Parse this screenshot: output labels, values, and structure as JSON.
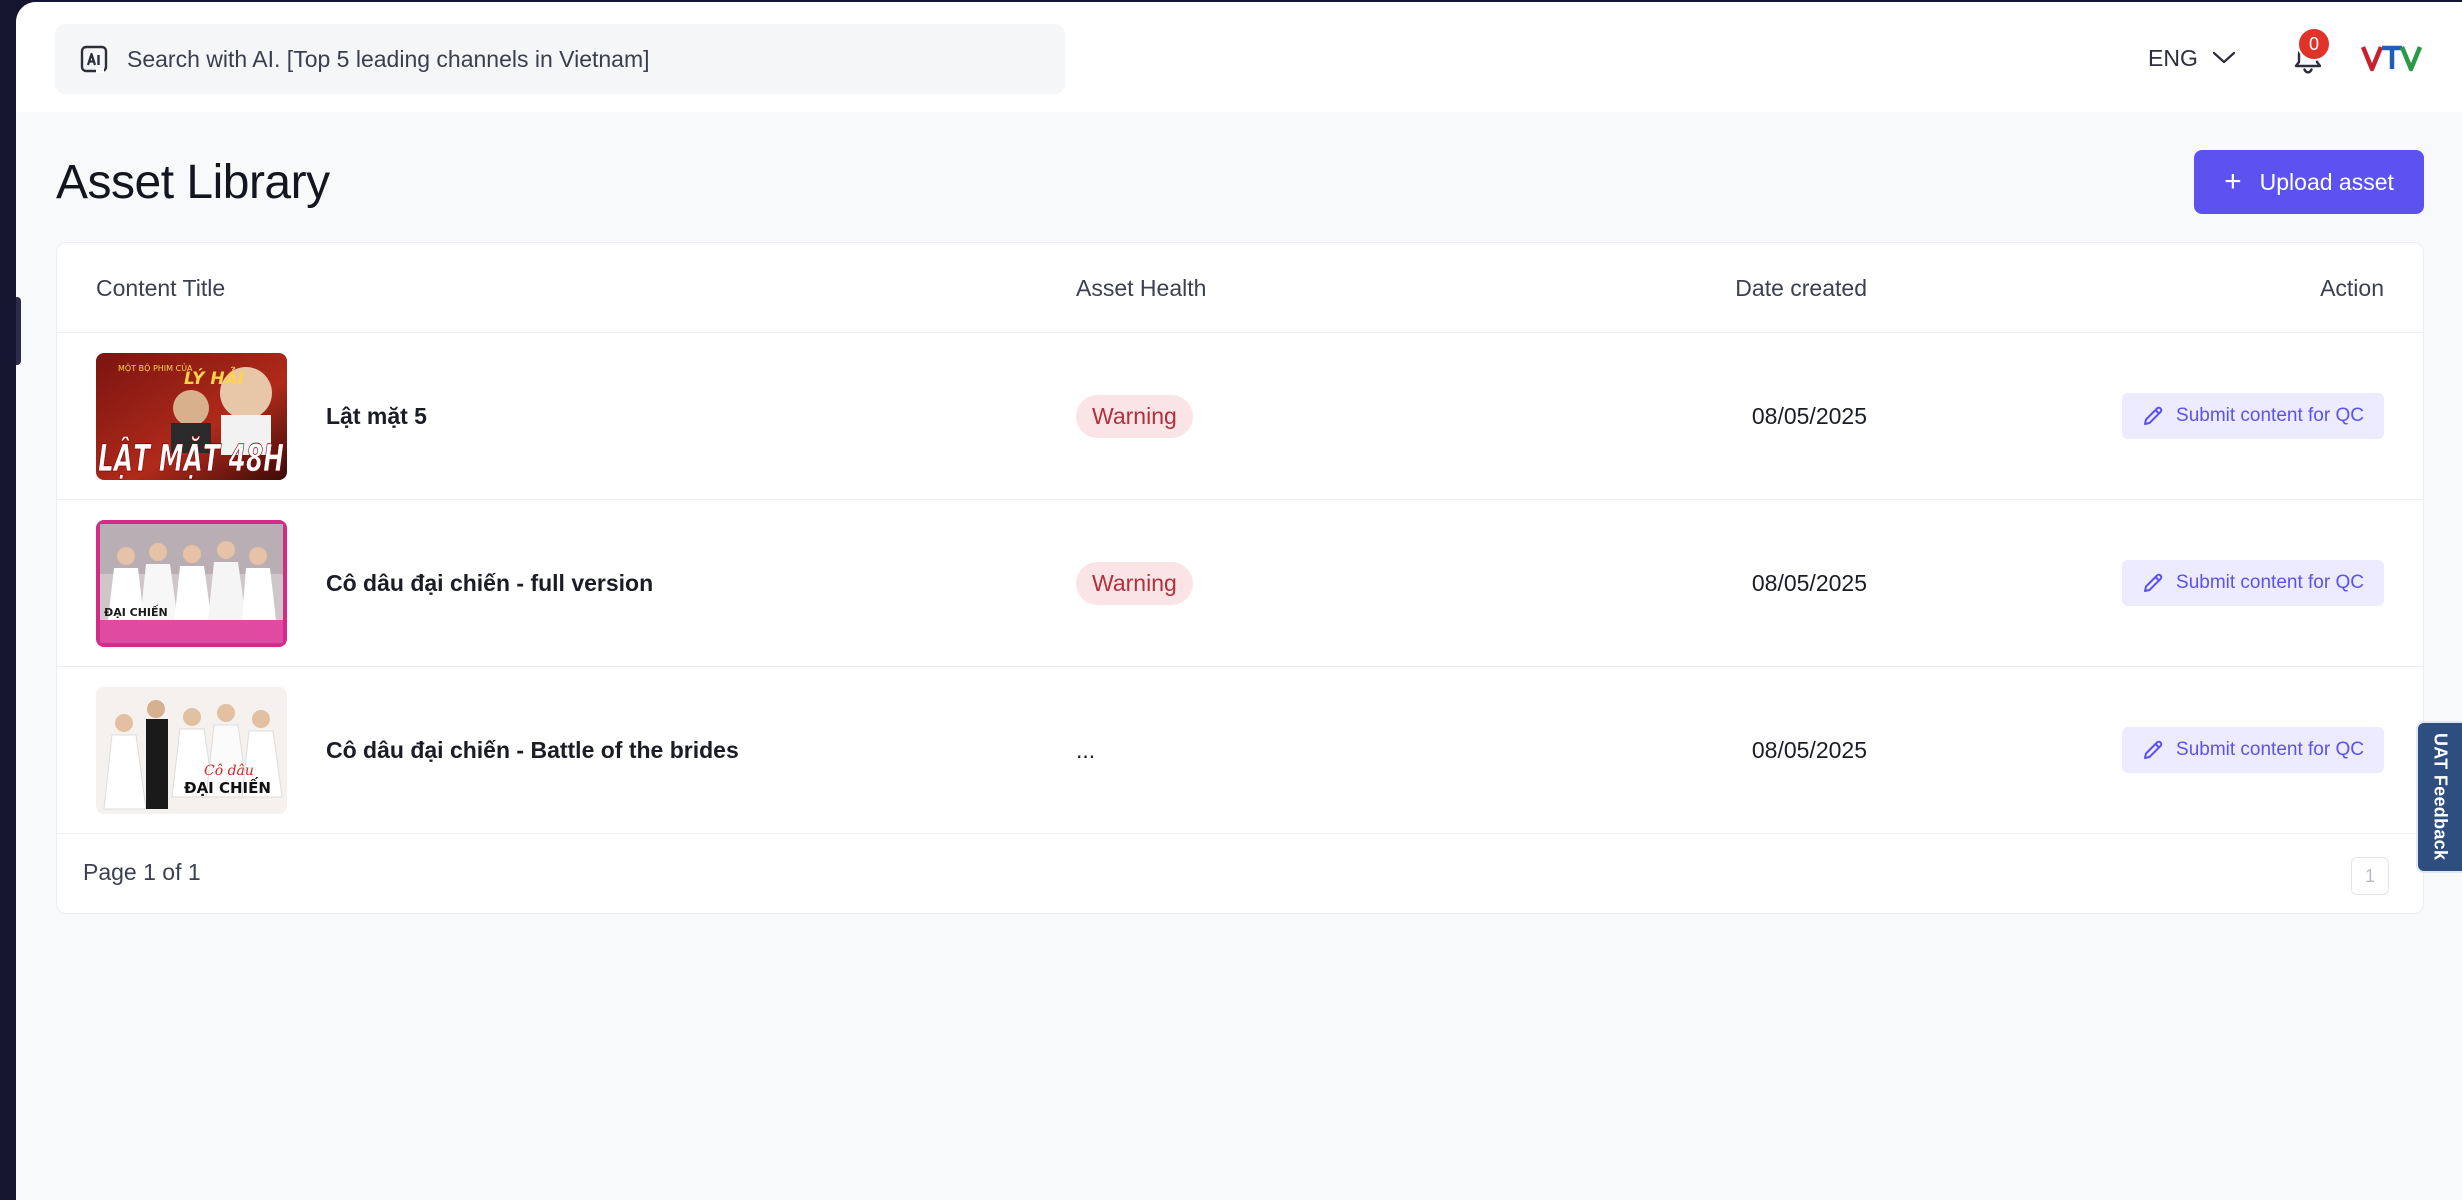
{
  "header": {
    "search_placeholder": "Search with AI. [Top 5 leading channels in Vietnam]",
    "language": "ENG",
    "notification_count": "0",
    "logo_text": "VTV"
  },
  "page": {
    "title": "Asset Library",
    "upload_label": "Upload asset",
    "upload_icon": "+"
  },
  "table": {
    "columns": {
      "content_title": "Content Title",
      "asset_health": "Asset Health",
      "date_created": "Date created",
      "action": "Action"
    },
    "rows": [
      {
        "title": "Lật mặt 5",
        "health": "Warning",
        "date": "08/05/2025",
        "action": "Submit content for QC",
        "thumb_text_top": "LÝ HẢI",
        "thumb_text_main": "LẬT MẶT 48H"
      },
      {
        "title": "Cô dâu đại chiến - full version",
        "health": "Warning",
        "date": "08/05/2025",
        "action": "Submit content for QC",
        "thumb_text_main": "ĐẠI CHIẾN"
      },
      {
        "title": "Cô dâu đại chiến - Battle of the brides",
        "health": "...",
        "date": "08/05/2025",
        "action": "Submit content for QC",
        "thumb_text_top": "Cô dâu",
        "thumb_text_main": "ĐẠI CHIẾN"
      }
    ]
  },
  "pagination": {
    "info": "Page 1 of 1",
    "current": "1"
  },
  "feedback_tab": "UAT Feedback",
  "colors": {
    "accent": "#5b52f0",
    "warning_bg": "#fbe4e6",
    "warning_text": "#b0303c",
    "badge_red": "#e0342b"
  }
}
